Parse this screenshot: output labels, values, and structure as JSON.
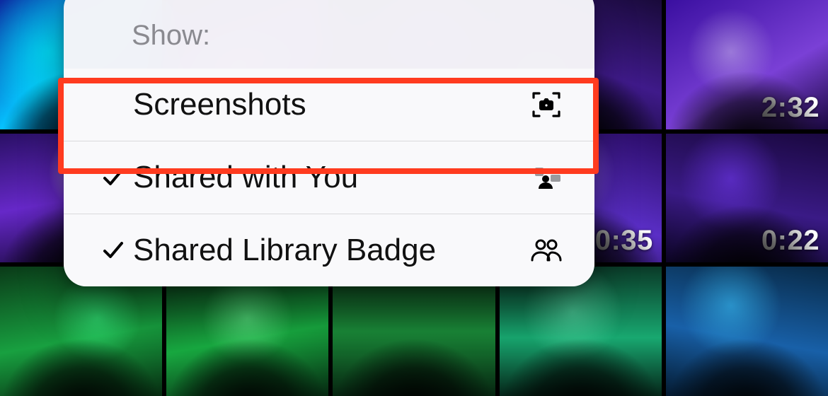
{
  "thumbnails": [
    {
      "duration": null
    },
    {
      "duration": null
    },
    {
      "duration": null
    },
    {
      "duration": null
    },
    {
      "duration": "2:32"
    },
    {
      "duration": null
    },
    {
      "duration": null
    },
    {
      "duration": null
    },
    {
      "duration": "0:35"
    },
    {
      "duration": "0:22"
    },
    {
      "duration": null
    },
    {
      "duration": null
    },
    {
      "duration": null
    },
    {
      "duration": null
    },
    {
      "duration": null
    }
  ],
  "menu": {
    "header": "Show:",
    "items": [
      {
        "checked": false,
        "label": "Screenshots",
        "icon": "screenshot",
        "highlighted": true
      },
      {
        "checked": true,
        "label": "Shared with You",
        "icon": "shared-with-you",
        "highlighted": false
      },
      {
        "checked": true,
        "label": "Shared Library Badge",
        "icon": "people",
        "highlighted": false
      }
    ]
  }
}
